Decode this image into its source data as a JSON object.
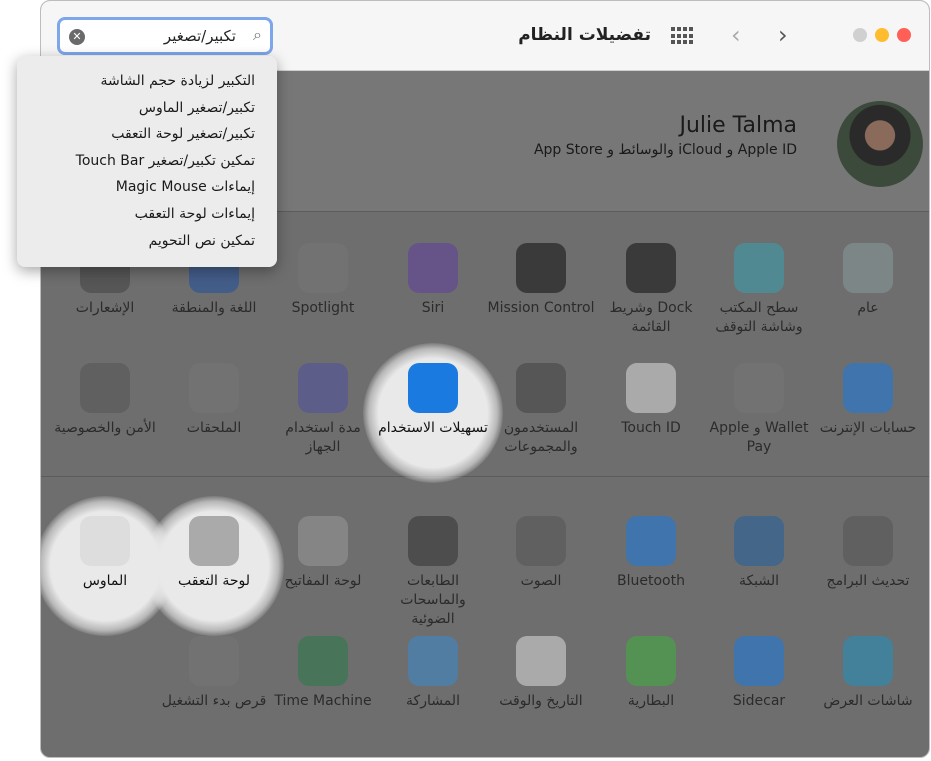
{
  "window": {
    "title": "تفضيلات النظام",
    "traffic_colors": [
      "#ff5f57",
      "#febc2e",
      "#d0d0d0"
    ]
  },
  "search": {
    "value": "تكبير/تصغير",
    "suggestions": [
      "التكبير لزيادة حجم الشاشة",
      "تكبير/تصغير الماوس",
      "تكبير/تصغير لوحة التعقب",
      "تمكين تكبير/تصغير Touch Bar",
      "إيماءات Magic Mouse",
      "إيماءات لوحة التعقب",
      "تمكين نص التحويم"
    ]
  },
  "account": {
    "name": "Julie Talma",
    "subtitle": "Apple ID و iCloud والوسائط و App Store"
  },
  "rows": [
    [
      {
        "label": "عام",
        "icon": "general-icon",
        "color": "#8a9a9a"
      },
      {
        "label": "سطح المكتب وشاشة التوقف",
        "icon": "desktop-icon",
        "color": "#3aa0b0"
      },
      {
        "label": "Dock وشريط القائمة",
        "icon": "dock-icon",
        "color": "#111"
      },
      {
        "label": "Mission Control",
        "icon": "mission-control-icon",
        "color": "#111"
      },
      {
        "label": "Siri",
        "icon": "siri-icon",
        "color": "#6040a0"
      },
      {
        "label": "Spotlight",
        "icon": "spotlight-icon",
        "color": "#777"
      },
      {
        "label": "اللغة والمنطقة",
        "icon": "language-icon",
        "color": "#2050a0"
      },
      {
        "label": "الإشعارات",
        "icon": "notifications-icon",
        "color": "#444"
      }
    ],
    [
      {
        "label": "حسابات الإنترنت",
        "icon": "internet-accounts-icon",
        "color": "#1a7ae0"
      },
      {
        "label": "Wallet و Apple Pay",
        "icon": "wallet-icon",
        "color": "#777"
      },
      {
        "label": "Touch ID",
        "icon": "touch-id-icon",
        "color": "#ddd"
      },
      {
        "label": "المستخدمون والمجموعات",
        "icon": "users-icon",
        "color": "#444"
      },
      {
        "label": "تسهيلات الاستخدام",
        "icon": "accessibility-icon",
        "color": "#1a7ae0",
        "highlight": true
      },
      {
        "label": "مدة استخدام الجهاز",
        "icon": "screen-time-icon",
        "color": "#5050a0"
      },
      {
        "label": "الملحقات",
        "icon": "extensions-icon",
        "color": "#777"
      },
      {
        "label": "الأمن والخصوصية",
        "icon": "security-icon",
        "color": "#555"
      }
    ],
    [
      {
        "label": "تحديث البرامج",
        "icon": "software-update-icon",
        "color": "#555"
      },
      {
        "label": "الشبكة",
        "icon": "network-icon",
        "color": "#2060a0"
      },
      {
        "label": "Bluetooth",
        "icon": "bluetooth-icon",
        "color": "#1a7ae0"
      },
      {
        "label": "الصوت",
        "icon": "sound-icon",
        "color": "#555"
      },
      {
        "label": "الطابعات والماسحات الضوئية",
        "icon": "printer-icon",
        "color": "#333"
      },
      {
        "label": "لوحة المفاتيح",
        "icon": "keyboard-icon",
        "color": "#999"
      },
      {
        "label": "لوحة التعقب",
        "icon": "trackpad-icon",
        "color": "#aaa",
        "highlight": true
      },
      {
        "label": "الماوس",
        "icon": "mouse-icon",
        "color": "#ddd",
        "highlight": true
      }
    ],
    [
      {
        "label": "شاشات العرض",
        "icon": "displays-icon",
        "color": "#2090c0"
      },
      {
        "label": "Sidecar",
        "icon": "sidecar-icon",
        "color": "#1a7ae0"
      },
      {
        "label": "البطارية",
        "icon": "battery-icon",
        "color": "#40b040"
      },
      {
        "label": "التاريخ والوقت",
        "icon": "date-time-icon",
        "color": "#ddd"
      },
      {
        "label": "المشاركة",
        "icon": "sharing-icon",
        "color": "#3a8ad0"
      },
      {
        "label": "Time Machine",
        "icon": "time-machine-icon",
        "color": "#2a7a4a"
      },
      {
        "label": "قرص بدء التشغيل",
        "icon": "startup-disk-icon",
        "color": "#777"
      }
    ]
  ]
}
